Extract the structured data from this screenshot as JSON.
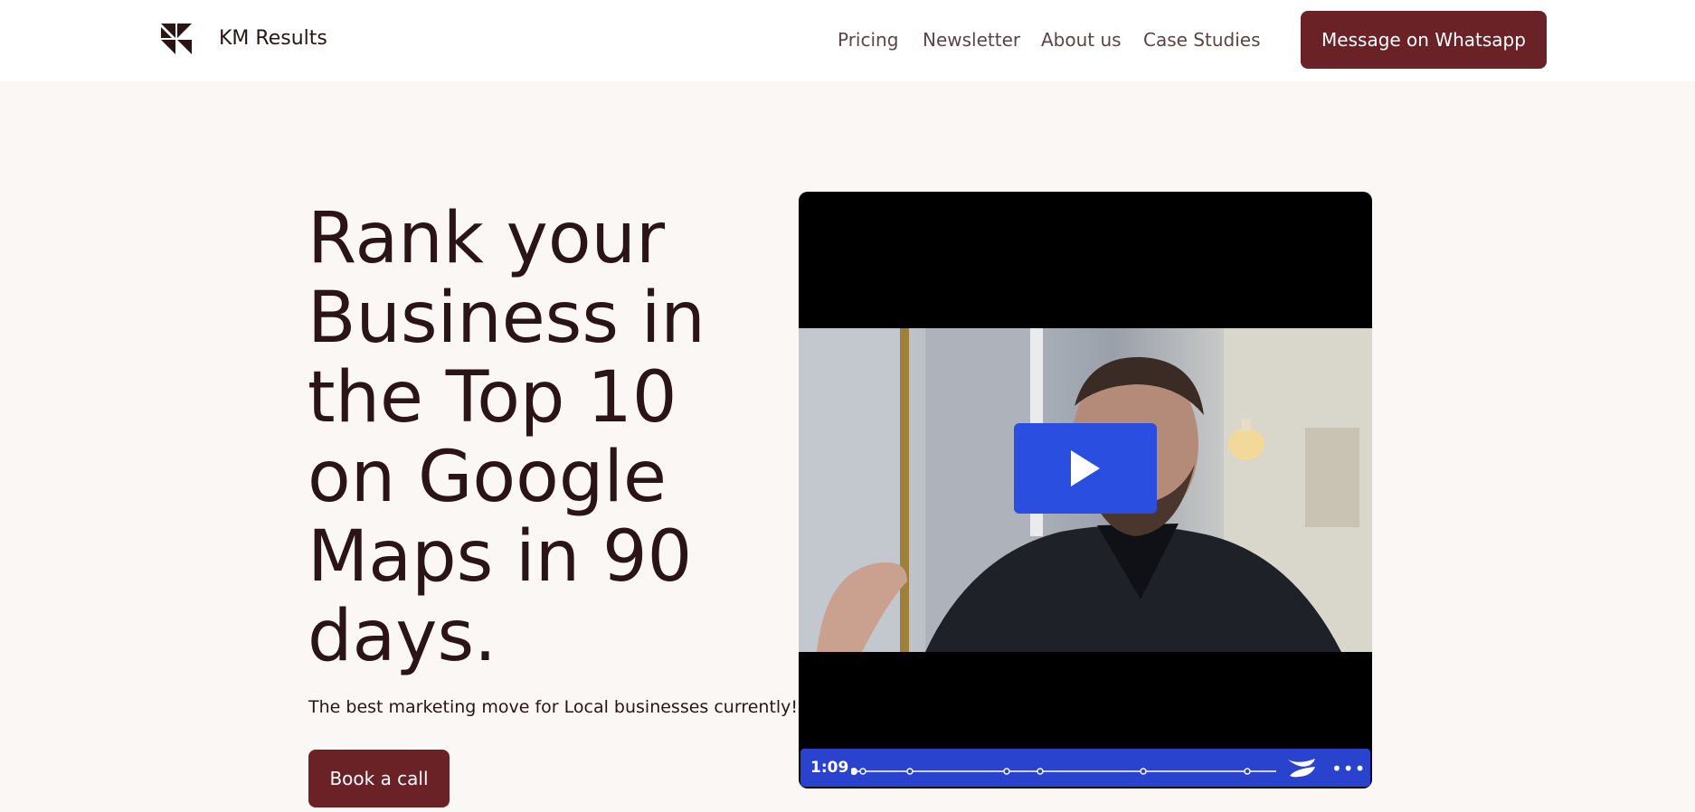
{
  "header": {
    "brand": "KM Results",
    "nav": [
      {
        "label": "Pricing"
      },
      {
        "label": "Newsletter"
      },
      {
        "label": "About us"
      },
      {
        "label": "Case Studies"
      }
    ],
    "cta_label": "Message on Whatsapp"
  },
  "hero": {
    "title_lines": [
      "Rank your",
      "Business in",
      "the Top 10",
      "on Google",
      "Maps in 90",
      "days."
    ],
    "subtitle": "The best marketing move for Local businesses currently!",
    "cta_label": "Book a call"
  },
  "video": {
    "duration": "1:09",
    "progress": 0
  },
  "colors": {
    "brand": "#6b2226",
    "text": "#2a1416",
    "background": "#fbf7f4",
    "player_accent": "#2a43cf"
  },
  "icons": {
    "logo": "km-results-logo-icon",
    "play": "play-icon",
    "player_brand": "wistia-logo-icon",
    "more": "more-options-icon"
  }
}
